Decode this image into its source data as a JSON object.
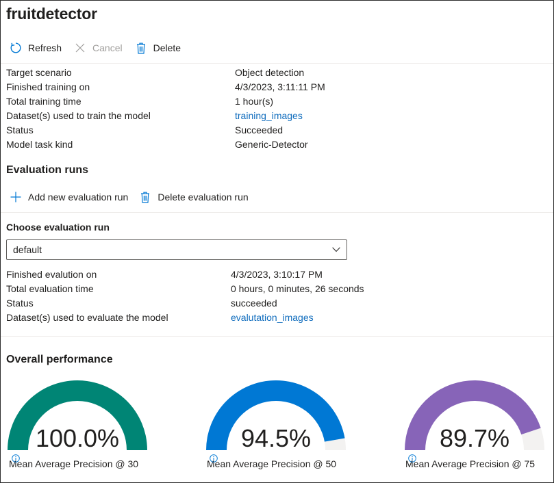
{
  "title": "fruitdetector",
  "toolbar": {
    "refresh_label": "Refresh",
    "cancel_label": "Cancel",
    "delete_label": "Delete"
  },
  "model_details": [
    {
      "label": "Target scenario",
      "value": "Object detection",
      "is_link": false
    },
    {
      "label": "Finished training on",
      "value": "4/3/2023, 3:11:11 PM",
      "is_link": false
    },
    {
      "label": "Total training time",
      "value": "1 hour(s)",
      "is_link": false
    },
    {
      "label": "Dataset(s) used to train the model",
      "value": "training_images",
      "is_link": true
    },
    {
      "label": "Status",
      "value": "Succeeded",
      "is_link": false
    },
    {
      "label": "Model task kind",
      "value": "Generic-Detector",
      "is_link": false
    }
  ],
  "evaluation": {
    "heading": "Evaluation runs",
    "add_label": "Add new evaluation run",
    "delete_label": "Delete evaluation run",
    "choose_label": "Choose evaluation run",
    "selected_run": "default",
    "details": [
      {
        "label": "Finished evalution on",
        "value": "4/3/2023, 3:10:17 PM",
        "is_link": false
      },
      {
        "label": "Total evaluation time",
        "value": "0 hours, 0 minutes, 26 seconds",
        "is_link": false
      },
      {
        "label": "Status",
        "value": "succeeded",
        "is_link": false
      },
      {
        "label": "Dataset(s) used to evaluate the model",
        "value": "evalutation_images",
        "is_link": true
      }
    ]
  },
  "performance": {
    "heading": "Overall performance",
    "track_color": "#f3f2f1",
    "gauges": [
      {
        "percent_label": "100.0%",
        "value": 100.0,
        "caption": "Mean Average Precision @ 30",
        "color": "#008575"
      },
      {
        "percent_label": "94.5%",
        "value": 94.5,
        "caption": "Mean Average Precision @ 50",
        "color": "#0078d4"
      },
      {
        "percent_label": "89.7%",
        "value": 89.7,
        "caption": "Mean Average Precision @ 75",
        "color": "#8764b8"
      }
    ]
  },
  "colors": {
    "link": "#0f6cbd",
    "icon_blue": "#0078d4",
    "disabled": "#a19f9d"
  }
}
